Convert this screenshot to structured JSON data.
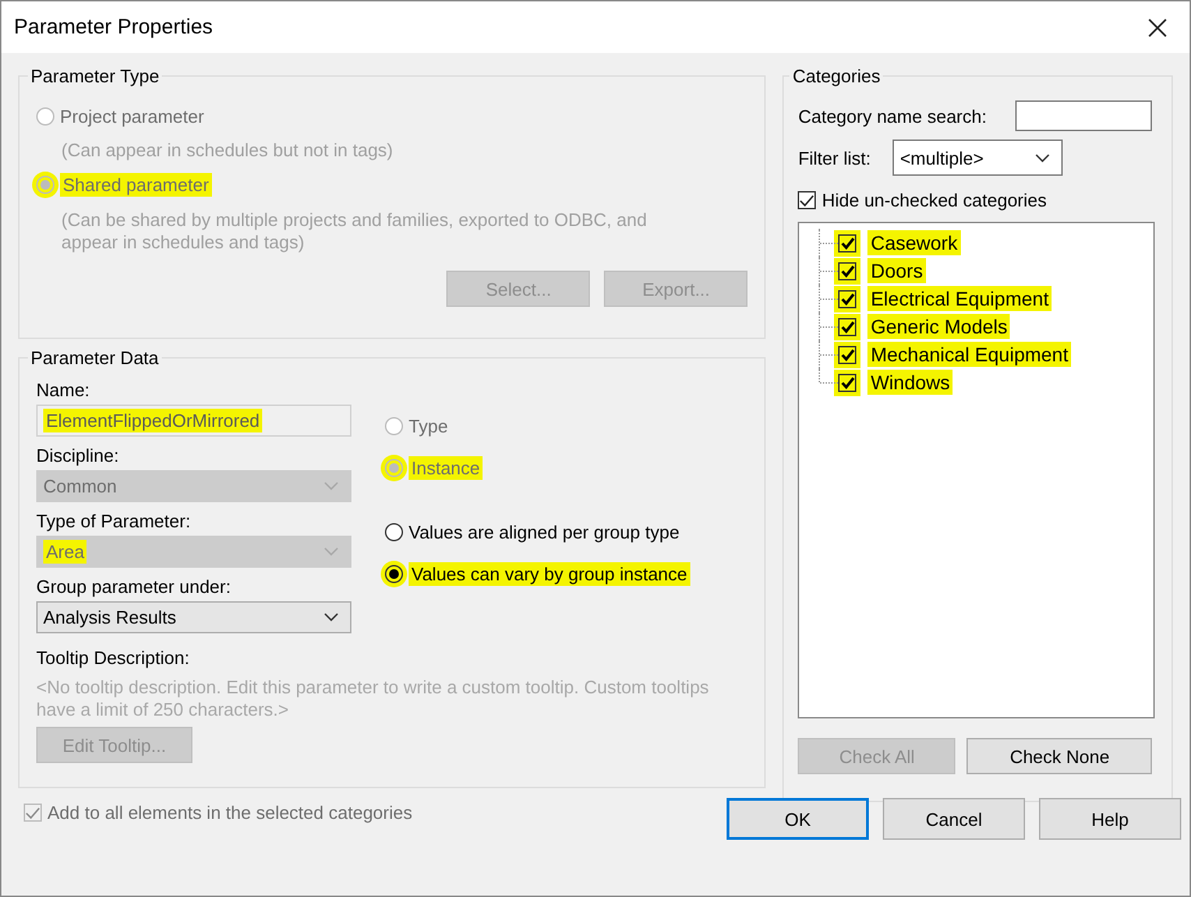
{
  "window": {
    "title": "Parameter Properties"
  },
  "parameter_type": {
    "title": "Parameter Type",
    "options": [
      {
        "label": "Project parameter",
        "description": "(Can appear in schedules but not in tags)",
        "selected": false,
        "disabled": true,
        "highlighted": false
      },
      {
        "label": "Shared parameter",
        "description": "(Can be shared by multiple projects and families, exported to ODBC, and appear in schedules and tags)",
        "selected": true,
        "disabled": true,
        "highlighted": true
      }
    ],
    "buttons": [
      {
        "label": "Select...",
        "disabled": true
      },
      {
        "label": "Export...",
        "disabled": true
      }
    ]
  },
  "parameter_data": {
    "title": "Parameter Data",
    "name": {
      "label": "Name:",
      "value": "ElementFlippedOrMirrored",
      "disabled": true,
      "highlighted": true
    },
    "discipline": {
      "label": "Discipline:",
      "value": "Common",
      "disabled": true,
      "highlighted": false
    },
    "type_of_parameter": {
      "label": "Type of Parameter:",
      "value": "Area",
      "disabled": true,
      "highlighted": true
    },
    "group_parameter_under": {
      "label": "Group parameter under:",
      "value": "Analysis Results",
      "disabled": false,
      "highlighted": false
    },
    "kind_options": [
      {
        "label": "Type",
        "selected": false,
        "disabled": true,
        "highlighted": false
      },
      {
        "label": "Instance",
        "selected": true,
        "disabled": true,
        "highlighted": true
      }
    ],
    "group_options": [
      {
        "label": "Values are aligned per group type",
        "selected": false,
        "disabled": false,
        "highlighted": false
      },
      {
        "label": "Values can vary by group instance",
        "selected": true,
        "disabled": false,
        "highlighted": true
      }
    ],
    "tooltip": {
      "label": "Tooltip Description:",
      "text": "<No tooltip description. Edit this parameter to write a custom tooltip. Custom tooltips have a limit of 250 characters.>",
      "button": {
        "label": "Edit Tooltip...",
        "disabled": true
      }
    }
  },
  "add_to_all": {
    "label": "Add to all elements in the selected categories",
    "checked": true,
    "disabled": true
  },
  "categories": {
    "title": "Categories",
    "search": {
      "label": "Category name search:"
    },
    "filter": {
      "label": "Filter list:",
      "value": "<multiple>"
    },
    "hide_unchecked": {
      "label": "Hide un-checked categories",
      "checked": true
    },
    "items": [
      {
        "label": "Casework",
        "checked": true,
        "highlighted": true
      },
      {
        "label": "Doors",
        "checked": true,
        "highlighted": true
      },
      {
        "label": "Electrical Equipment",
        "checked": true,
        "highlighted": true
      },
      {
        "label": "Generic Models",
        "checked": true,
        "highlighted": true
      },
      {
        "label": "Mechanical Equipment",
        "checked": true,
        "highlighted": true
      },
      {
        "label": "Windows",
        "checked": true,
        "highlighted": true
      }
    ],
    "buttons": [
      {
        "label": "Check All",
        "disabled": true
      },
      {
        "label": "Check None",
        "disabled": false
      }
    ]
  },
  "buttons": [
    {
      "label": "OK",
      "default": true
    },
    {
      "label": "Cancel",
      "default": false
    },
    {
      "label": "Help",
      "default": false
    }
  ]
}
